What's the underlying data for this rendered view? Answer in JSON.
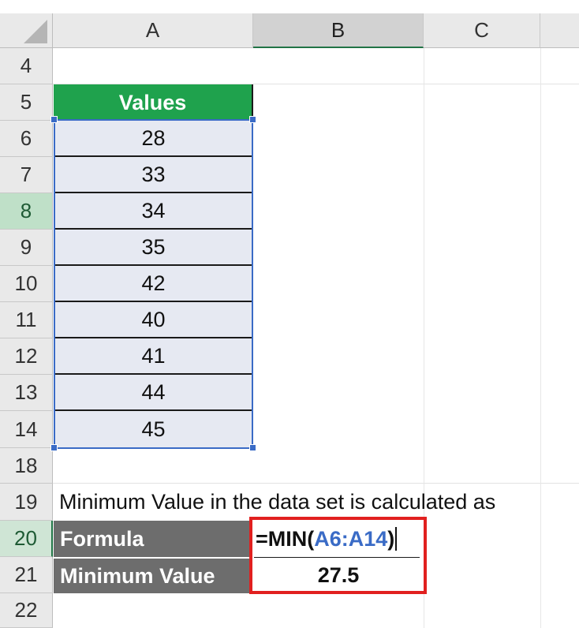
{
  "columns": {
    "corner": "",
    "a": "A",
    "b": "B",
    "c": "C"
  },
  "rows": [
    "4",
    "5",
    "6",
    "7",
    "8",
    "9",
    "10",
    "11",
    "12",
    "13",
    "14",
    "18",
    "19",
    "20",
    "21",
    "22"
  ],
  "table": {
    "header": "Values",
    "values": [
      "28",
      "33",
      "34",
      "35",
      "42",
      "40",
      "41",
      "44",
      "45"
    ]
  },
  "note": "Minimum Value in the data set is calculated as",
  "formula_row": {
    "label": "Formula",
    "formula_prefix": "=MIN(",
    "formula_range": "A6:A14",
    "formula_suffix": ")"
  },
  "result_row": {
    "label": "Minimum Value",
    "value": "27.5"
  },
  "colors": {
    "header_green": "#1fa24d",
    "label_gray": "#6d6d6d",
    "range_blue": "#3a6bc6",
    "highlight_red": "#e1201f",
    "selection_green": "#217346"
  }
}
